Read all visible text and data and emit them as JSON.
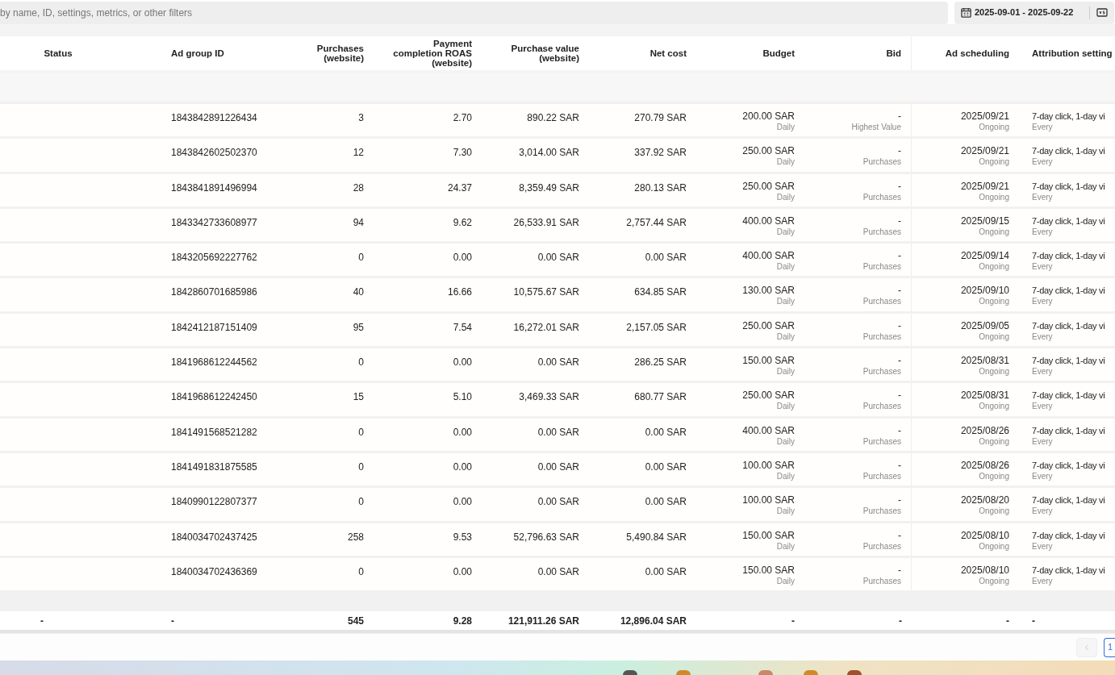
{
  "search": {
    "placeholder": "by name, ID, settings, metrics, or other filters"
  },
  "date_range": {
    "label": "2025-09-01 - 2025-09-22"
  },
  "columns": [
    "Status",
    "Ad group ID",
    "Purchases (website)",
    "Payment completion ROAS (website)",
    "Purchase value (website)",
    "Net cost",
    "Budget",
    "Bid",
    "Ad scheduling",
    "Attribution setting"
  ],
  "rows": [
    {
      "id": "1843842891226434",
      "purchases": "3",
      "roas": "2.70",
      "purchase_value": "890.22 SAR",
      "net_cost": "270.79 SAR",
      "budget": "200.00 SAR",
      "budget_type": "Daily",
      "bid": "-",
      "bid_strategy": "Highest Value",
      "schedule": "2025/09/21",
      "schedule_state": "Ongoing",
      "attribution": "7-day click, 1-day vi",
      "attribution_sub": "Every"
    },
    {
      "id": "1843842602502370",
      "purchases": "12",
      "roas": "7.30",
      "purchase_value": "3,014.00 SAR",
      "net_cost": "337.92 SAR",
      "budget": "250.00 SAR",
      "budget_type": "Daily",
      "bid": "-",
      "bid_strategy": "Purchases",
      "schedule": "2025/09/21",
      "schedule_state": "Ongoing",
      "attribution": "7-day click, 1-day vi",
      "attribution_sub": "Every"
    },
    {
      "id": "1843841891496994",
      "purchases": "28",
      "roas": "24.37",
      "purchase_value": "8,359.49 SAR",
      "net_cost": "280.13 SAR",
      "budget": "250.00 SAR",
      "budget_type": "Daily",
      "bid": "-",
      "bid_strategy": "Purchases",
      "schedule": "2025/09/21",
      "schedule_state": "Ongoing",
      "attribution": "7-day click, 1-day vi",
      "attribution_sub": "Every"
    },
    {
      "id": "1843342733608977",
      "purchases": "94",
      "roas": "9.62",
      "purchase_value": "26,533.91 SAR",
      "net_cost": "2,757.44 SAR",
      "budget": "400.00 SAR",
      "budget_type": "Daily",
      "bid": "-",
      "bid_strategy": "Purchases",
      "schedule": "2025/09/15",
      "schedule_state": "Ongoing",
      "attribution": "7-day click, 1-day vi",
      "attribution_sub": "Every"
    },
    {
      "id": "1843205692227762",
      "purchases": "0",
      "roas": "0.00",
      "purchase_value": "0.00 SAR",
      "net_cost": "0.00 SAR",
      "budget": "400.00 SAR",
      "budget_type": "Daily",
      "bid": "-",
      "bid_strategy": "Purchases",
      "schedule": "2025/09/14",
      "schedule_state": "Ongoing",
      "attribution": "7-day click, 1-day vi",
      "attribution_sub": "Every"
    },
    {
      "id": "1842860701685986",
      "purchases": "40",
      "roas": "16.66",
      "purchase_value": "10,575.67 SAR",
      "net_cost": "634.85 SAR",
      "budget": "130.00 SAR",
      "budget_type": "Daily",
      "bid": "-",
      "bid_strategy": "Purchases",
      "schedule": "2025/09/10",
      "schedule_state": "Ongoing",
      "attribution": "7-day click, 1-day vi",
      "attribution_sub": "Every"
    },
    {
      "id": "1842412187151409",
      "purchases": "95",
      "roas": "7.54",
      "purchase_value": "16,272.01 SAR",
      "net_cost": "2,157.05 SAR",
      "budget": "250.00 SAR",
      "budget_type": "Daily",
      "bid": "-",
      "bid_strategy": "Purchases",
      "schedule": "2025/09/05",
      "schedule_state": "Ongoing",
      "attribution": "7-day click, 1-day vi",
      "attribution_sub": "Every"
    },
    {
      "id": "1841968612244562",
      "purchases": "0",
      "roas": "0.00",
      "purchase_value": "0.00 SAR",
      "net_cost": "286.25 SAR",
      "budget": "150.00 SAR",
      "budget_type": "Daily",
      "bid": "-",
      "bid_strategy": "Purchases",
      "schedule": "2025/08/31",
      "schedule_state": "Ongoing",
      "attribution": "7-day click, 1-day vi",
      "attribution_sub": "Every"
    },
    {
      "id": "1841968612242450",
      "purchases": "15",
      "roas": "5.10",
      "purchase_value": "3,469.33 SAR",
      "net_cost": "680.77 SAR",
      "budget": "250.00 SAR",
      "budget_type": "Daily",
      "bid": "-",
      "bid_strategy": "Purchases",
      "schedule": "2025/08/31",
      "schedule_state": "Ongoing",
      "attribution": "7-day click, 1-day vi",
      "attribution_sub": "Every"
    },
    {
      "id": "1841491568521282",
      "purchases": "0",
      "roas": "0.00",
      "purchase_value": "0.00 SAR",
      "net_cost": "0.00 SAR",
      "budget": "400.00 SAR",
      "budget_type": "Daily",
      "bid": "-",
      "bid_strategy": "Purchases",
      "schedule": "2025/08/26",
      "schedule_state": "Ongoing",
      "attribution": "7-day click, 1-day vi",
      "attribution_sub": "Every"
    },
    {
      "id": "1841491831875585",
      "purchases": "0",
      "roas": "0.00",
      "purchase_value": "0.00 SAR",
      "net_cost": "0.00 SAR",
      "budget": "100.00 SAR",
      "budget_type": "Daily",
      "bid": "-",
      "bid_strategy": "Purchases",
      "schedule": "2025/08/26",
      "schedule_state": "Ongoing",
      "attribution": "7-day click, 1-day vi",
      "attribution_sub": "Every"
    },
    {
      "id": "1840990122807377",
      "purchases": "0",
      "roas": "0.00",
      "purchase_value": "0.00 SAR",
      "net_cost": "0.00 SAR",
      "budget": "100.00 SAR",
      "budget_type": "Daily",
      "bid": "-",
      "bid_strategy": "Purchases",
      "schedule": "2025/08/20",
      "schedule_state": "Ongoing",
      "attribution": "7-day click, 1-day vi",
      "attribution_sub": "Every"
    },
    {
      "id": "1840034702437425",
      "purchases": "258",
      "roas": "9.53",
      "purchase_value": "52,796.63 SAR",
      "net_cost": "5,490.84 SAR",
      "budget": "150.00 SAR",
      "budget_type": "Daily",
      "bid": "-",
      "bid_strategy": "Purchases",
      "schedule": "2025/08/10",
      "schedule_state": "Ongoing",
      "attribution": "7-day click, 1-day vi",
      "attribution_sub": "Every"
    },
    {
      "id": "1840034702436369",
      "purchases": "0",
      "roas": "0.00",
      "purchase_value": "0.00 SAR",
      "net_cost": "0.00 SAR",
      "budget": "150.00 SAR",
      "budget_type": "Daily",
      "bid": "-",
      "bid_strategy": "Purchases",
      "schedule": "2025/08/10",
      "schedule_state": "Ongoing",
      "attribution": "7-day click, 1-day vi",
      "attribution_sub": "Every"
    }
  ],
  "totals": [
    "-",
    "-",
    "545",
    "9.28",
    "121,911.26 SAR",
    "12,896.04 SAR",
    "-",
    "-",
    "-",
    "-"
  ],
  "pagination": {
    "prev_disabled": true,
    "pages": [
      {
        "label": "1",
        "selected": true
      }
    ]
  }
}
